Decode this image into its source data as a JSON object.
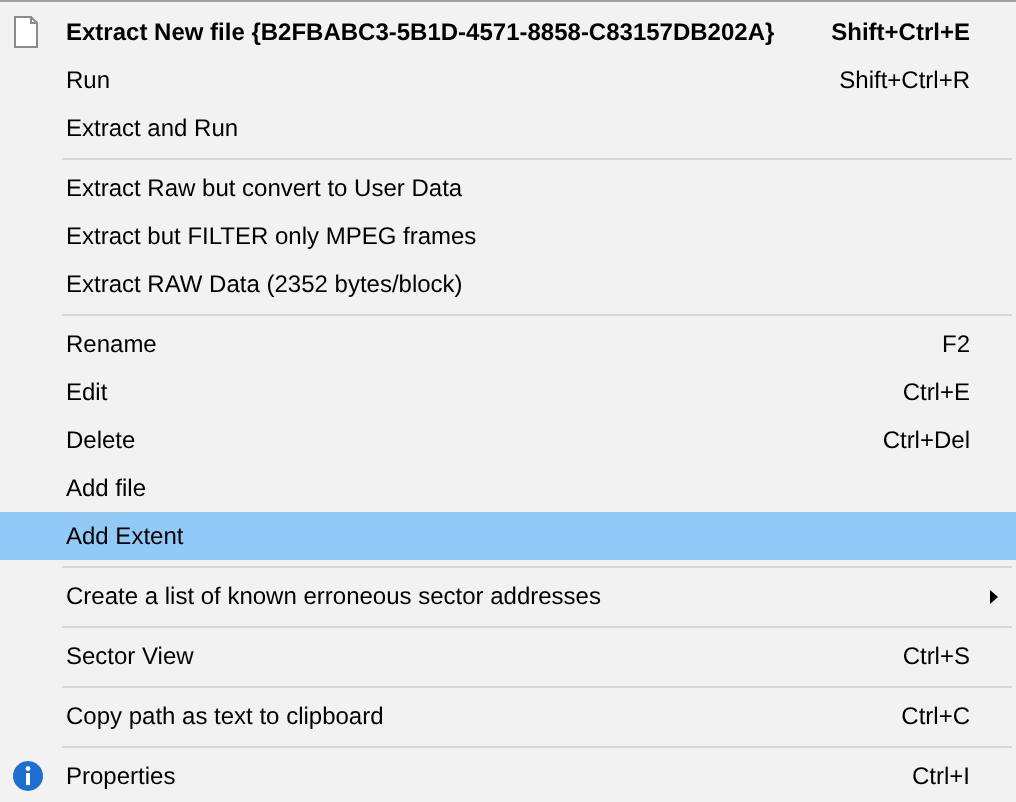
{
  "menu": {
    "groups": [
      {
        "items": [
          {
            "kind": "document",
            "label": "Extract New file {B2FBABC3-5B1D-4571-8858-C83157DB202A}",
            "shortcut": "Shift+Ctrl+E",
            "default": true,
            "selected": false,
            "submenu": false
          },
          {
            "kind": "plain",
            "label": "Run",
            "shortcut": "Shift+Ctrl+R",
            "default": false,
            "selected": false,
            "submenu": false
          },
          {
            "kind": "plain",
            "label": "Extract and Run",
            "default": false,
            "selected": false,
            "submenu": false
          }
        ]
      },
      {
        "items": [
          {
            "kind": "plain",
            "label": "Extract Raw but convert to User Data",
            "default": false,
            "selected": false,
            "submenu": false
          },
          {
            "kind": "plain",
            "label": "Extract but FILTER only MPEG frames",
            "default": false,
            "selected": false,
            "submenu": false
          },
          {
            "kind": "plain",
            "label": "Extract RAW Data (2352 bytes/block)",
            "default": false,
            "selected": false,
            "submenu": false
          }
        ]
      },
      {
        "items": [
          {
            "kind": "plain",
            "label": "Rename",
            "shortcut": "F2",
            "default": false,
            "selected": false,
            "submenu": false
          },
          {
            "kind": "plain",
            "label": "Edit",
            "shortcut": "Ctrl+E",
            "default": false,
            "selected": false,
            "submenu": false
          },
          {
            "kind": "plain",
            "label": "Delete",
            "shortcut": "Ctrl+Del",
            "default": false,
            "selected": false,
            "submenu": false
          },
          {
            "kind": "plain",
            "label": "Add file",
            "default": false,
            "selected": false,
            "submenu": false
          },
          {
            "kind": "plain",
            "label": "Add Extent",
            "default": false,
            "selected": true,
            "submenu": false
          }
        ]
      },
      {
        "items": [
          {
            "kind": "plain",
            "label": "Create a list of known erroneous sector addresses",
            "default": false,
            "selected": false,
            "submenu": true
          }
        ]
      },
      {
        "items": [
          {
            "kind": "plain",
            "label": "Sector View",
            "shortcut": "Ctrl+S",
            "default": false,
            "selected": false,
            "submenu": false
          }
        ]
      },
      {
        "items": [
          {
            "kind": "plain",
            "label": "Copy path as text to clipboard",
            "shortcut": "Ctrl+C",
            "default": false,
            "selected": false,
            "submenu": false
          }
        ]
      },
      {
        "items": [
          {
            "kind": "info",
            "label": "Properties",
            "shortcut": "Ctrl+I",
            "default": false,
            "selected": false,
            "submenu": false
          }
        ]
      }
    ]
  }
}
